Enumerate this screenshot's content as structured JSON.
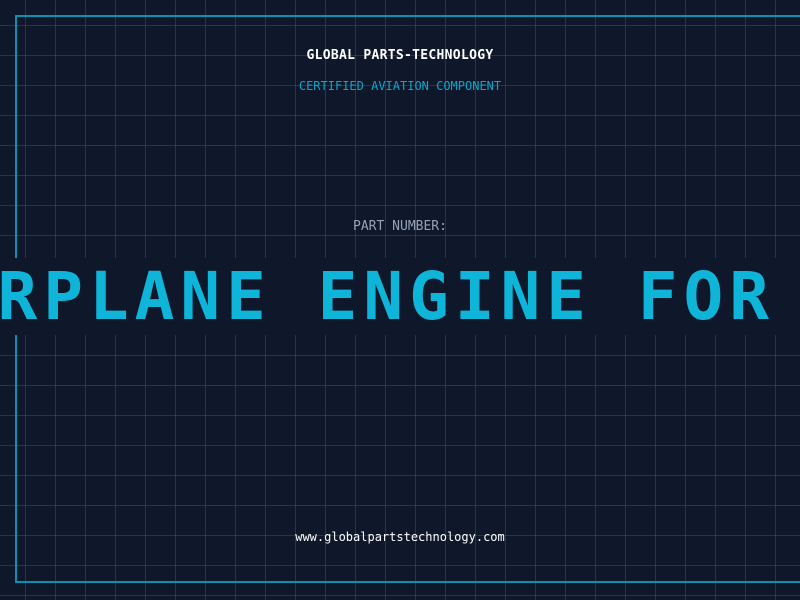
{
  "header": {
    "company": "GLOBAL PARTS-TECHNOLOGY",
    "subtitle": "CERTIFIED AVIATION COMPONENT"
  },
  "part": {
    "label": "PART NUMBER:",
    "scrolling_text": "AIRPLANE ENGINE FOR SALE"
  },
  "footer": {
    "website": "www.globalpartstechnology.com"
  },
  "colors": {
    "background": "#0f172b",
    "grid": "#0891b2",
    "accent": "#0fb5d8",
    "label": "#94a3b8",
    "text": "#ffffff"
  }
}
